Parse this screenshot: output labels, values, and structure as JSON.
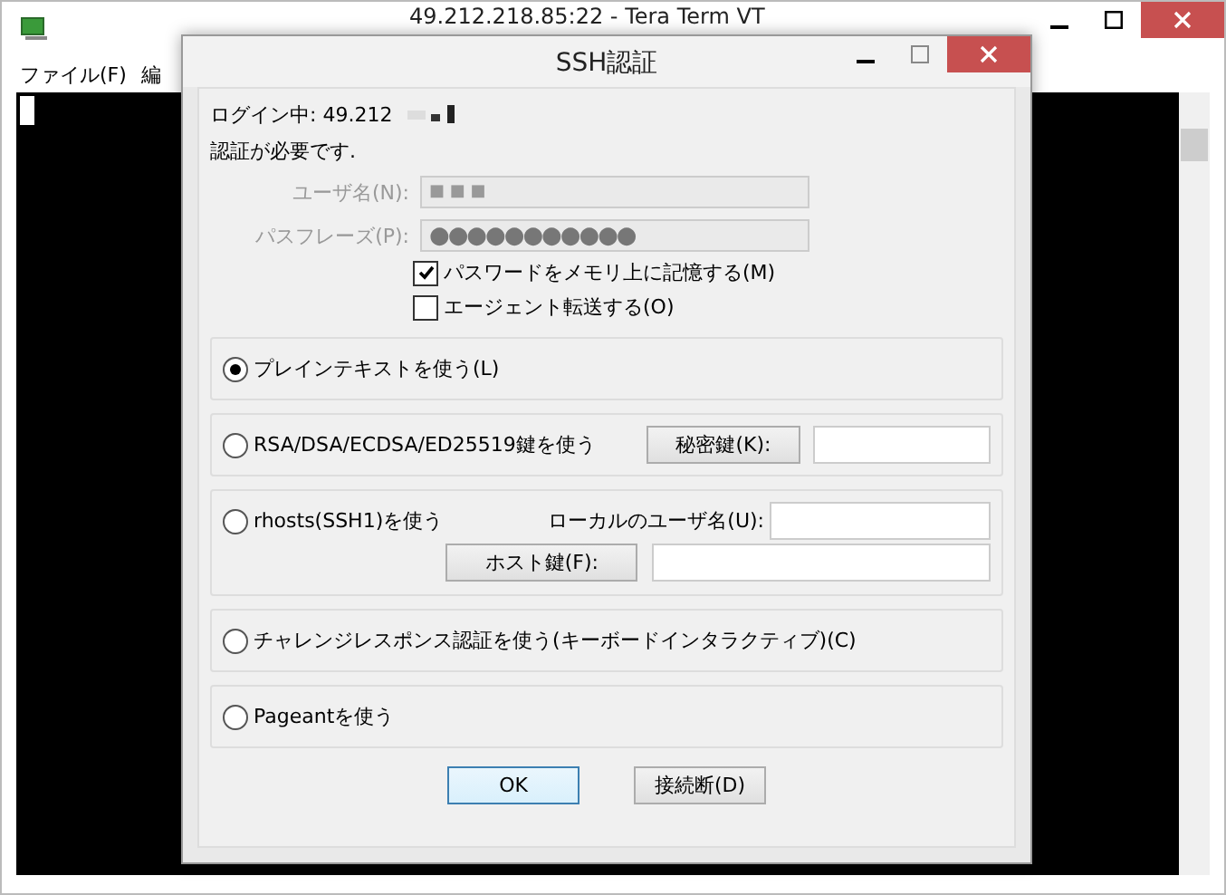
{
  "window": {
    "title": "49.212.218.85:22 - Tera Term VT"
  },
  "menu": [
    {
      "label": "ファイル(F)"
    },
    {
      "label": "編"
    }
  ],
  "dialog": {
    "title": "SSH認証",
    "login": "ログイン中: 49.212",
    "message": "認証が必要です.",
    "username": {
      "label": "ユーザ名(N):",
      "value": "■ ■ ■",
      "disabled": true
    },
    "passphrase": {
      "label": "パスフレーズ(P):",
      "value": "●●●●●●●●●●●",
      "disabled": true
    },
    "checkboxes": [
      {
        "label": "パスワードをメモリ上に記憶する(M)",
        "checked": true
      },
      {
        "label": "エージェント転送する(O)",
        "checked": false
      }
    ],
    "methods": [
      {
        "kind": "plain",
        "label": "プレインテキストを使う(L)",
        "selected": true
      },
      {
        "kind": "key",
        "label": "RSA/DSA/ECDSA/ED25519鍵を使う",
        "selected": false,
        "button": "秘密鍵(K):"
      },
      {
        "kind": "rhosts",
        "label": "rhosts(SSH1)を使う",
        "selected": false,
        "field_label": "ローカルのユーザ名(U):",
        "button": "ホスト鍵(F):"
      },
      {
        "kind": "plain",
        "label": "チャレンジレスポンス認証を使う(キーボードインタラクティブ)(C)",
        "selected": false
      },
      {
        "kind": "plain",
        "label": "Pageantを使う",
        "selected": false
      }
    ],
    "buttons": [
      {
        "label": "OK",
        "default": true
      },
      {
        "label": "接続断(D)",
        "default": false
      }
    ]
  }
}
